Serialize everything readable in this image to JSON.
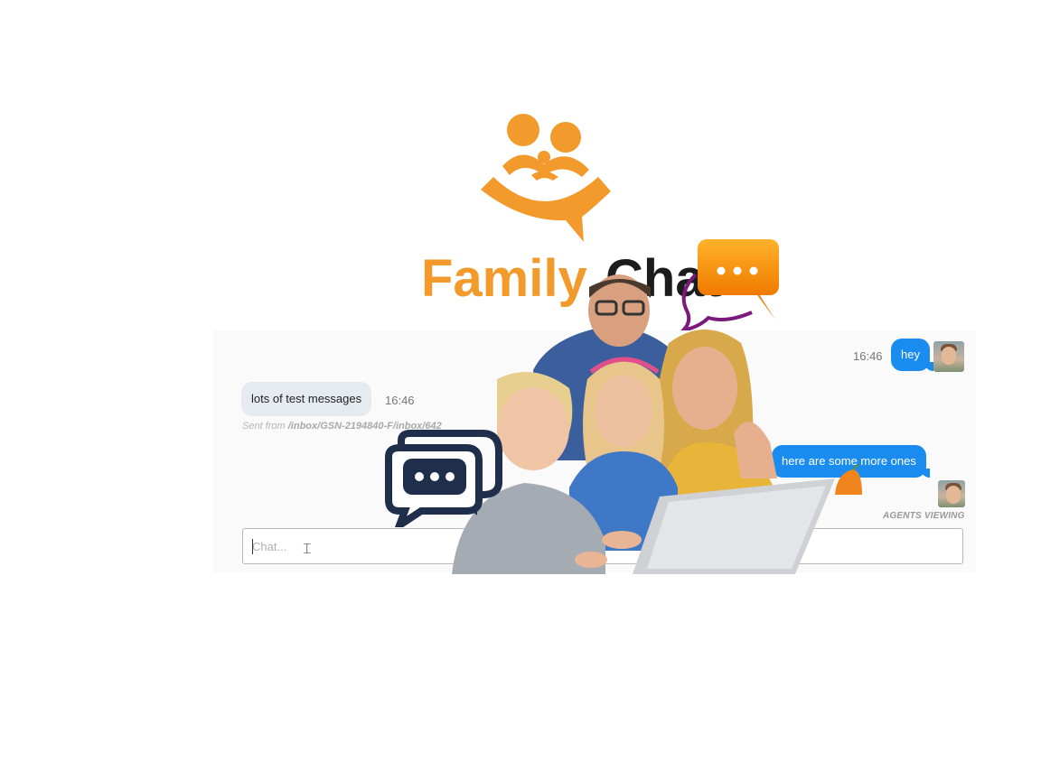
{
  "logo": {
    "word1": "Family",
    "word2": "Chat",
    "icons": [
      "family-people-icon",
      "chat-bubble-dots-icon"
    ],
    "colors": {
      "orange": "#f39a2d",
      "dark": "#1c1c1c",
      "purple": "#7b1a7a"
    }
  },
  "chat": {
    "messages": [
      {
        "direction": "out",
        "text": "hey",
        "time": "16:46"
      },
      {
        "direction": "in",
        "text": "lots of test messages",
        "time": "16:46",
        "sent_from_label": "Sent from",
        "sent_from_path": "/inbox/GSN-2194840-F/inbox/642"
      },
      {
        "direction": "out",
        "text": "here are some more ones"
      }
    ],
    "agents_viewing": "AGENTS VIEWING",
    "input": {
      "placeholder": "Chat..."
    },
    "colors": {
      "outgoing": "#1a8cf0",
      "incoming": "#e6ebf2"
    }
  },
  "overlay": {
    "icons": [
      "family-photo",
      "typing-bubble-icon",
      "laptop-icon"
    ]
  }
}
